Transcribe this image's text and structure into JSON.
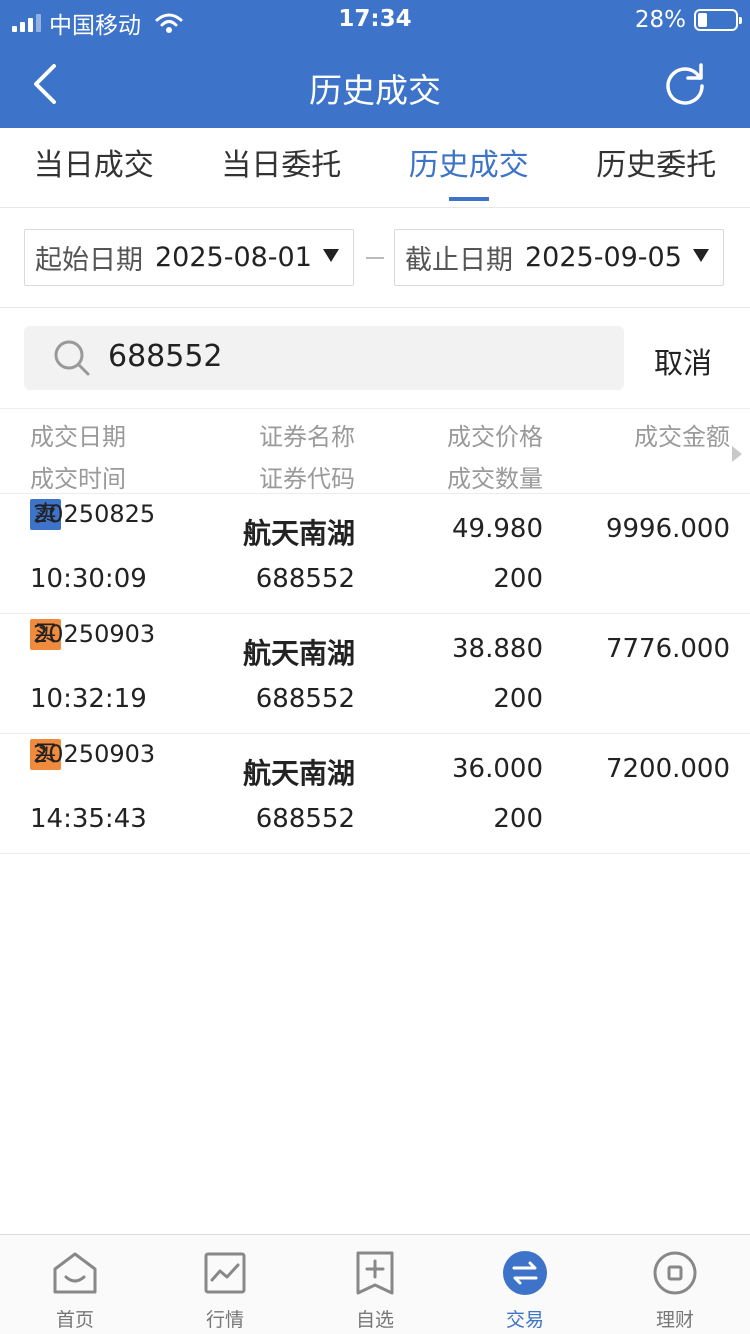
{
  "status_bar": {
    "carrier": "中国移动",
    "time": "17:34",
    "battery": "28%"
  },
  "nav": {
    "title": "历史成交"
  },
  "tabs": [
    {
      "label": "当日成交",
      "active": false
    },
    {
      "label": "当日委托",
      "active": false
    },
    {
      "label": "历史成交",
      "active": true
    },
    {
      "label": "历史委托",
      "active": false
    }
  ],
  "filters": {
    "start": {
      "label": "起始日期",
      "value": "2025-08-01"
    },
    "end": {
      "label": "截止日期",
      "value": "2025-09-05"
    }
  },
  "search": {
    "value": "688552",
    "cancel": "取消"
  },
  "table": {
    "headers": {
      "date": "成交日期",
      "time": "成交时间",
      "name": "证券名称",
      "code": "证券代码",
      "price": "成交价格",
      "qty": "成交数量",
      "amount": "成交金额"
    },
    "rows": [
      {
        "side": "卖",
        "side_type": "sell",
        "date": "20250825",
        "time": "10:30:09",
        "name": "航天南湖",
        "code": "688552",
        "price": "49.980",
        "qty": "200",
        "amount": "9996.000"
      },
      {
        "side": "买",
        "side_type": "buy",
        "date": "20250903",
        "time": "10:32:19",
        "name": "航天南湖",
        "code": "688552",
        "price": "38.880",
        "qty": "200",
        "amount": "7776.000"
      },
      {
        "side": "买",
        "side_type": "buy",
        "date": "20250903",
        "time": "14:35:43",
        "name": "航天南湖",
        "code": "688552",
        "price": "36.000",
        "qty": "200",
        "amount": "7200.000"
      }
    ]
  },
  "bottom_nav": [
    {
      "label": "首页",
      "icon": "home-icon",
      "active": false
    },
    {
      "label": "行情",
      "icon": "market-chart-icon",
      "active": false
    },
    {
      "label": "自选",
      "icon": "watchlist-add-icon",
      "active": false
    },
    {
      "label": "交易",
      "icon": "trade-exchange-icon",
      "active": true
    },
    {
      "label": "理财",
      "icon": "wealth-coin-icon",
      "active": false
    }
  ],
  "colors": {
    "primary": "#3d73c9",
    "buy": "#f08a3c",
    "sell": "#3d73c9"
  }
}
